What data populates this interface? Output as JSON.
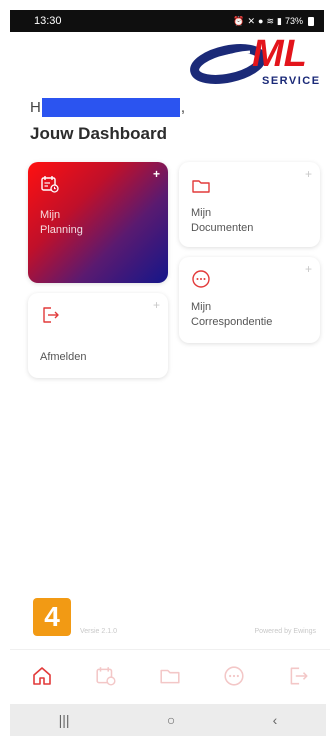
{
  "status_bar": {
    "time": "13:30",
    "icons": [
      "alarm-icon",
      "mute-icon",
      "location-icon",
      "wifi-icon",
      "signal-icon"
    ],
    "battery": "73%"
  },
  "logo": {
    "brand": "ML",
    "tagline": "SERVICE",
    "colors": {
      "red": "#e3141b",
      "navy": "#1b2a78"
    }
  },
  "greeting": {
    "prefix": "H",
    "suffix": ","
  },
  "dashboard_title": "Jouw Dashboard",
  "tiles": [
    {
      "name": "Mijn Planning",
      "label_line1": "Mijn",
      "label_line2": "Planning",
      "icon": "calendar-clock-icon",
      "plus": "+",
      "highlighted": true
    },
    {
      "name": "Mijn Documenten",
      "label_line1": "Mijn",
      "label_line2": "Documenten",
      "icon": "folder-icon",
      "plus": "+"
    },
    {
      "name": "Mijn Correspondentie",
      "label_line1": "Mijn",
      "label_line2": "Correspondentie",
      "icon": "chat-bubble-icon",
      "plus": "+"
    },
    {
      "name": "Afmelden",
      "label_line1": "Afmelden",
      "label_line2": "",
      "icon": "logout-icon",
      "plus": "+"
    }
  ],
  "footer": {
    "badge": "4",
    "version": "Versie 2.1.0",
    "powered": "Powered by Ewings"
  },
  "bottom_nav": [
    "home-icon",
    "calendar-clock-icon",
    "folder-icon",
    "chat-bubble-icon",
    "logout-icon"
  ],
  "system_nav": {
    "recents": "|||",
    "home": "○",
    "back": "‹"
  },
  "colors": {
    "accent_red": "#e23a3a",
    "nav_faded": "#f3c7c7",
    "badge_orange": "#f29a14",
    "redaction_blue": "#2b54f0"
  }
}
